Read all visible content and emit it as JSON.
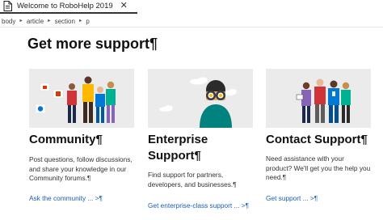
{
  "tab": {
    "title": "Welcome to RoboHelp 2019",
    "close_glyph": "✕",
    "icon": "document-icon"
  },
  "breadcrumb": [
    "body",
    "article",
    "section",
    "p"
  ],
  "breadcrumb_separator": "►",
  "page": {
    "title": "Get more support¶"
  },
  "cards": [
    {
      "heading": "Community¶",
      "description": "Post questions, follow discussions, and share your knowledge in our Community forums.¶",
      "link": "Ask the community ... >¶"
    },
    {
      "heading": "Enterprise Support¶",
      "description": "Find support for partners, developers, and businesses.¶",
      "link": "Get enterprise-class support ... >¶"
    },
    {
      "heading": "Contact Support¶",
      "description": "Need assistance with your product? We'll get you the help you need.¶",
      "link": "Get support ... >¶"
    }
  ],
  "colors": {
    "link": "#1a5fb4",
    "image_bg": "#ebebeb",
    "title": "#111111"
  }
}
